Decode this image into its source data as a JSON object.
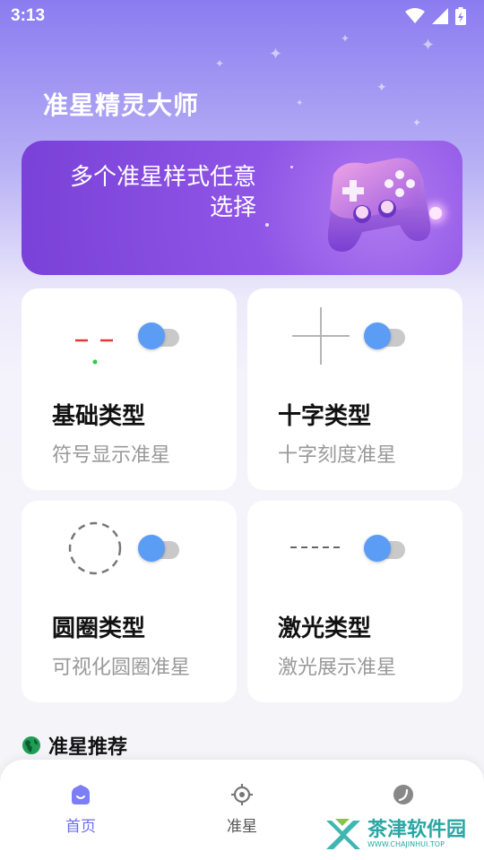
{
  "status_bar": {
    "time": "3:13",
    "icons": [
      "wifi-icon",
      "cellular-signal-icon",
      "battery-charging-icon"
    ]
  },
  "app_title": "准星精灵大师",
  "banner": {
    "text": "多个准星样式任意选择",
    "illustration": "gamepad-icon"
  },
  "cards": [
    {
      "title": "基础类型",
      "subtitle": "符号显示准星",
      "preview": "dash-dot-crosshair",
      "enabled": true
    },
    {
      "title": "十字类型",
      "subtitle": "十字刻度准星",
      "preview": "cross-crosshair",
      "enabled": true
    },
    {
      "title": "圆圈类型",
      "subtitle": "可视化圆圈准星",
      "preview": "dashed-circle-crosshair",
      "enabled": true
    },
    {
      "title": "激光类型",
      "subtitle": "激光展示准星",
      "preview": "dashed-line-crosshair",
      "enabled": true
    }
  ],
  "section": {
    "title": "准星推荐",
    "icon": "globe-icon"
  },
  "nav": [
    {
      "label": "首页",
      "icon": "home-icon",
      "active": true
    },
    {
      "label": "准星",
      "icon": "crosshair-icon",
      "active": false
    },
    {
      "label": "",
      "icon": "moon-icon",
      "active": false
    }
  ],
  "watermark": {
    "title": "茶津软件园",
    "subtitle": "WWW.CHAJINHUI.TOP"
  },
  "colors": {
    "accent": "#6b6ef0",
    "toggle": "#5b9cf5",
    "banner": "#8f55e6"
  }
}
